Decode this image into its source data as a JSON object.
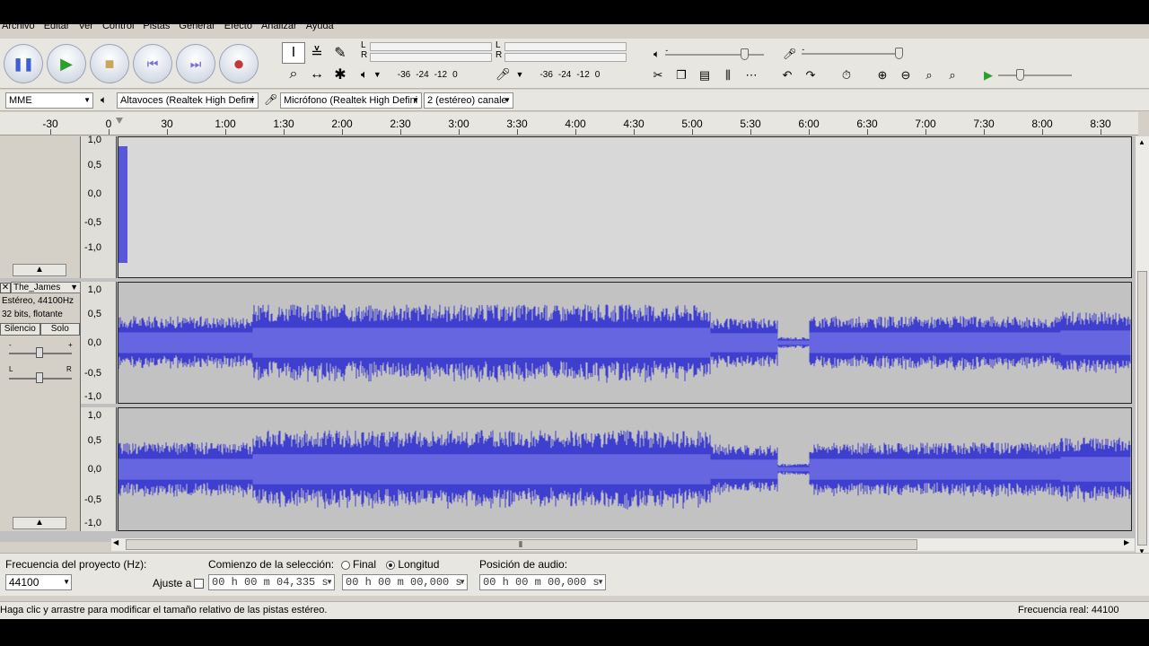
{
  "menu": [
    "Archivo",
    "Editar",
    "Ver",
    "Control",
    "Pistas",
    "Generar",
    "Efecto",
    "Analizar",
    "Ayuda"
  ],
  "meters": {
    "playback": {
      "left": "L",
      "right": "R",
      "scale": [
        "-36",
        "-24",
        "-12",
        "0"
      ]
    },
    "record": {
      "left": "L",
      "right": "R",
      "scale": [
        "-36",
        "-24",
        "-12",
        "0"
      ]
    }
  },
  "devices": {
    "host": "MME",
    "output": "Altavoces (Realtek High Defini",
    "input": "Micrófono (Realtek High Defini",
    "channels": "2 (estéreo) canale"
  },
  "ruler": {
    "labels": [
      "-30",
      "0",
      "30",
      "1:00",
      "1:30",
      "2:00",
      "2:30",
      "3:00",
      "3:30",
      "4:00",
      "4:30",
      "5:00",
      "5:30",
      "6:00",
      "6:30",
      "7:00",
      "7:30",
      "8:00",
      "8:30"
    ]
  },
  "scale_labels": [
    "1,0",
    "0,5",
    "0,0",
    "-0,5",
    "-1,0"
  ],
  "track": {
    "name": "The_James",
    "info1": "Estéreo, 44100Hz",
    "info2": "32 bits, flotante",
    "mute": "Silencio",
    "solo": "Solo",
    "pan_left": "L",
    "pan_right": "R",
    "gain_minus": "-",
    "gain_plus": "+"
  },
  "selection": {
    "rate_label": "Frecuencia del proyecto (Hz):",
    "rate_value": "44100",
    "snap_label": "Ajuste a",
    "start_label": "Comienzo de la selección:",
    "end_option": "Final",
    "length_option": "Longitud",
    "start_value": "00 h 00 m 04,335 s",
    "length_value": "00 h 00 m 00,000 s",
    "audio_pos_label": "Posición de audio:",
    "audio_pos_value": "00 h 00 m 00,000 s"
  },
  "status": {
    "message": "Haga clic y arrastre para modificar el tamaño relativo de las pistas estéreo.",
    "rate": "Frecuencia real: 44100"
  },
  "colors": {
    "waveform": "#3f3fcf",
    "waveform_rms": "#6666e0",
    "track_bg": "#c2c2c2"
  }
}
